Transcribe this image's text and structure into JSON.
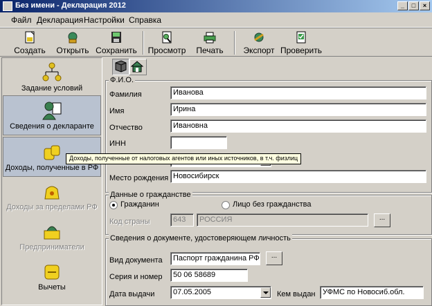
{
  "window": {
    "title": "Без имени - Декларация 2012"
  },
  "menu": [
    "Файл",
    "Декларация",
    "Настройки",
    "Справка"
  ],
  "toolbar": {
    "create": "Создать",
    "open": "Открыть",
    "save": "Сохранить",
    "preview": "Просмотр",
    "print": "Печать",
    "export": "Экспорт",
    "check": "Проверить"
  },
  "sidebar": {
    "items": [
      {
        "label": "Задание условий",
        "state": "normal"
      },
      {
        "label": "Сведения о декларанте",
        "state": "selected"
      },
      {
        "label": "Доходы, полученные в РФ",
        "state": "hover"
      },
      {
        "label": "Доходы за пределами РФ",
        "state": "disabled"
      },
      {
        "label": "Предприниматели",
        "state": "disabled"
      },
      {
        "label": "Вычеты",
        "state": "normal"
      }
    ]
  },
  "tooltip": "Доходы, полученные от налоговых агентов или иных источников, в т.ч. физлиц",
  "fio": {
    "title": "Ф.И.О.",
    "surname_label": "Фамилия",
    "surname": "Иванова",
    "name_label": "Имя",
    "name": "Ирина",
    "patronymic_label": "Отчество",
    "patronymic": "Ивановна",
    "inn_label": "ИНН",
    "inn": "",
    "birthplace_label": "Место рождения",
    "birthplace": "Новосибирск"
  },
  "citizenship": {
    "title": "Данные о гражданстве",
    "citizen": "Гражданин",
    "stateless": "Лицо без гражданства",
    "country_label": "Код страны",
    "country_code": "643",
    "country_name": "РОССИЯ",
    "button": "..."
  },
  "document": {
    "title": "Сведения о документе, удостоверяющем личность",
    "type_label": "Вид документа",
    "type": "Паспорт гражданина РФ",
    "button": "...",
    "number_label": "Серия и номер",
    "number": "50 06 58689",
    "date_label": "Дата выдачи",
    "date": "07.05.2005",
    "issuer_label": "Кем выдан",
    "issuer": "УФМС по Новосиб.обл."
  }
}
